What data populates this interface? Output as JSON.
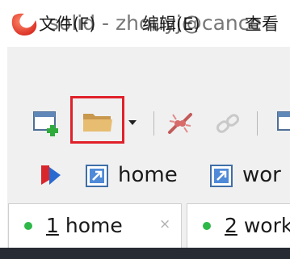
{
  "window": {
    "title": "solid - zhouyj@cance"
  },
  "menu": {
    "items": [
      {
        "label": "文件(F)"
      },
      {
        "label": "编辑(E)"
      },
      {
        "label": "查看"
      }
    ]
  },
  "toolbar": {
    "buttons": [
      {
        "icon": "new-window-icon"
      },
      {
        "icon": "open-folder-icon",
        "highlighted": true
      },
      {
        "icon": "dropdown-arrow-icon"
      },
      {
        "icon": "disconnect-icon"
      },
      {
        "icon": "reconnect-icon"
      },
      {
        "icon": "window-icon"
      }
    ]
  },
  "bookmarks": {
    "items": [
      {
        "icon": "bookmark-flag-icon"
      },
      {
        "icon": "session-link-icon",
        "label": "home"
      },
      {
        "icon": "session-link-icon",
        "label": "wor"
      }
    ]
  },
  "tabs": [
    {
      "number": "1",
      "name": " home",
      "close": "×",
      "status_color": "#2fb84a"
    },
    {
      "number": "2",
      "name": " work",
      "status_color": "#2fb84a"
    }
  ],
  "colors": {
    "highlight": "#e0202a",
    "logo": "#e8403a"
  }
}
